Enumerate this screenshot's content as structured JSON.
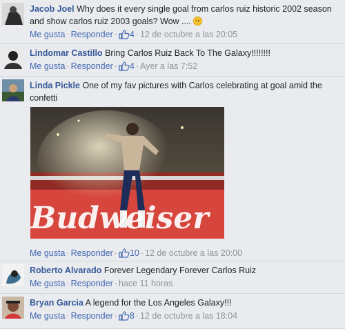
{
  "actions": {
    "like": "Me gusta",
    "reply": "Responder"
  },
  "icons": {
    "like_count": "thumbs-up-icon",
    "emoji": "smiley-icon"
  },
  "comments": [
    {
      "author": "Jacob Joel",
      "text": "Why does it every single goal from carlos ruiz historic 2002 season and show carlos ruiz 2003 goals? Wow ....",
      "likes": "4",
      "time": "12 de octubre a las 20:05"
    },
    {
      "author": "Lindomar Castillo",
      "text": "Bring Carlos Ruiz Back To The Galaxy!!!!!!!!",
      "likes": "4",
      "time": "Ayer a las 7:52"
    },
    {
      "author": "Linda Pickle",
      "text": "One of my fav pictures with Carlos celebrating at goal amid the confetti",
      "photo_text": "Budweiser",
      "likes": "10",
      "time": "12 de octubre a las 20:00"
    },
    {
      "author": "Roberto Alvarado",
      "text": "Forever Legendary Forever Carlos Ruiz",
      "time": "hace 11 horas"
    },
    {
      "author": "Bryan Garcia",
      "text": "A legend for the Los Angeles Galaxy!!!",
      "likes": "8",
      "time": "12 de octubre a las 18:04"
    }
  ],
  "colors": {
    "background": "#e9ebee",
    "name": "#365899",
    "link": "#4267b2",
    "meta": "#90949c"
  }
}
